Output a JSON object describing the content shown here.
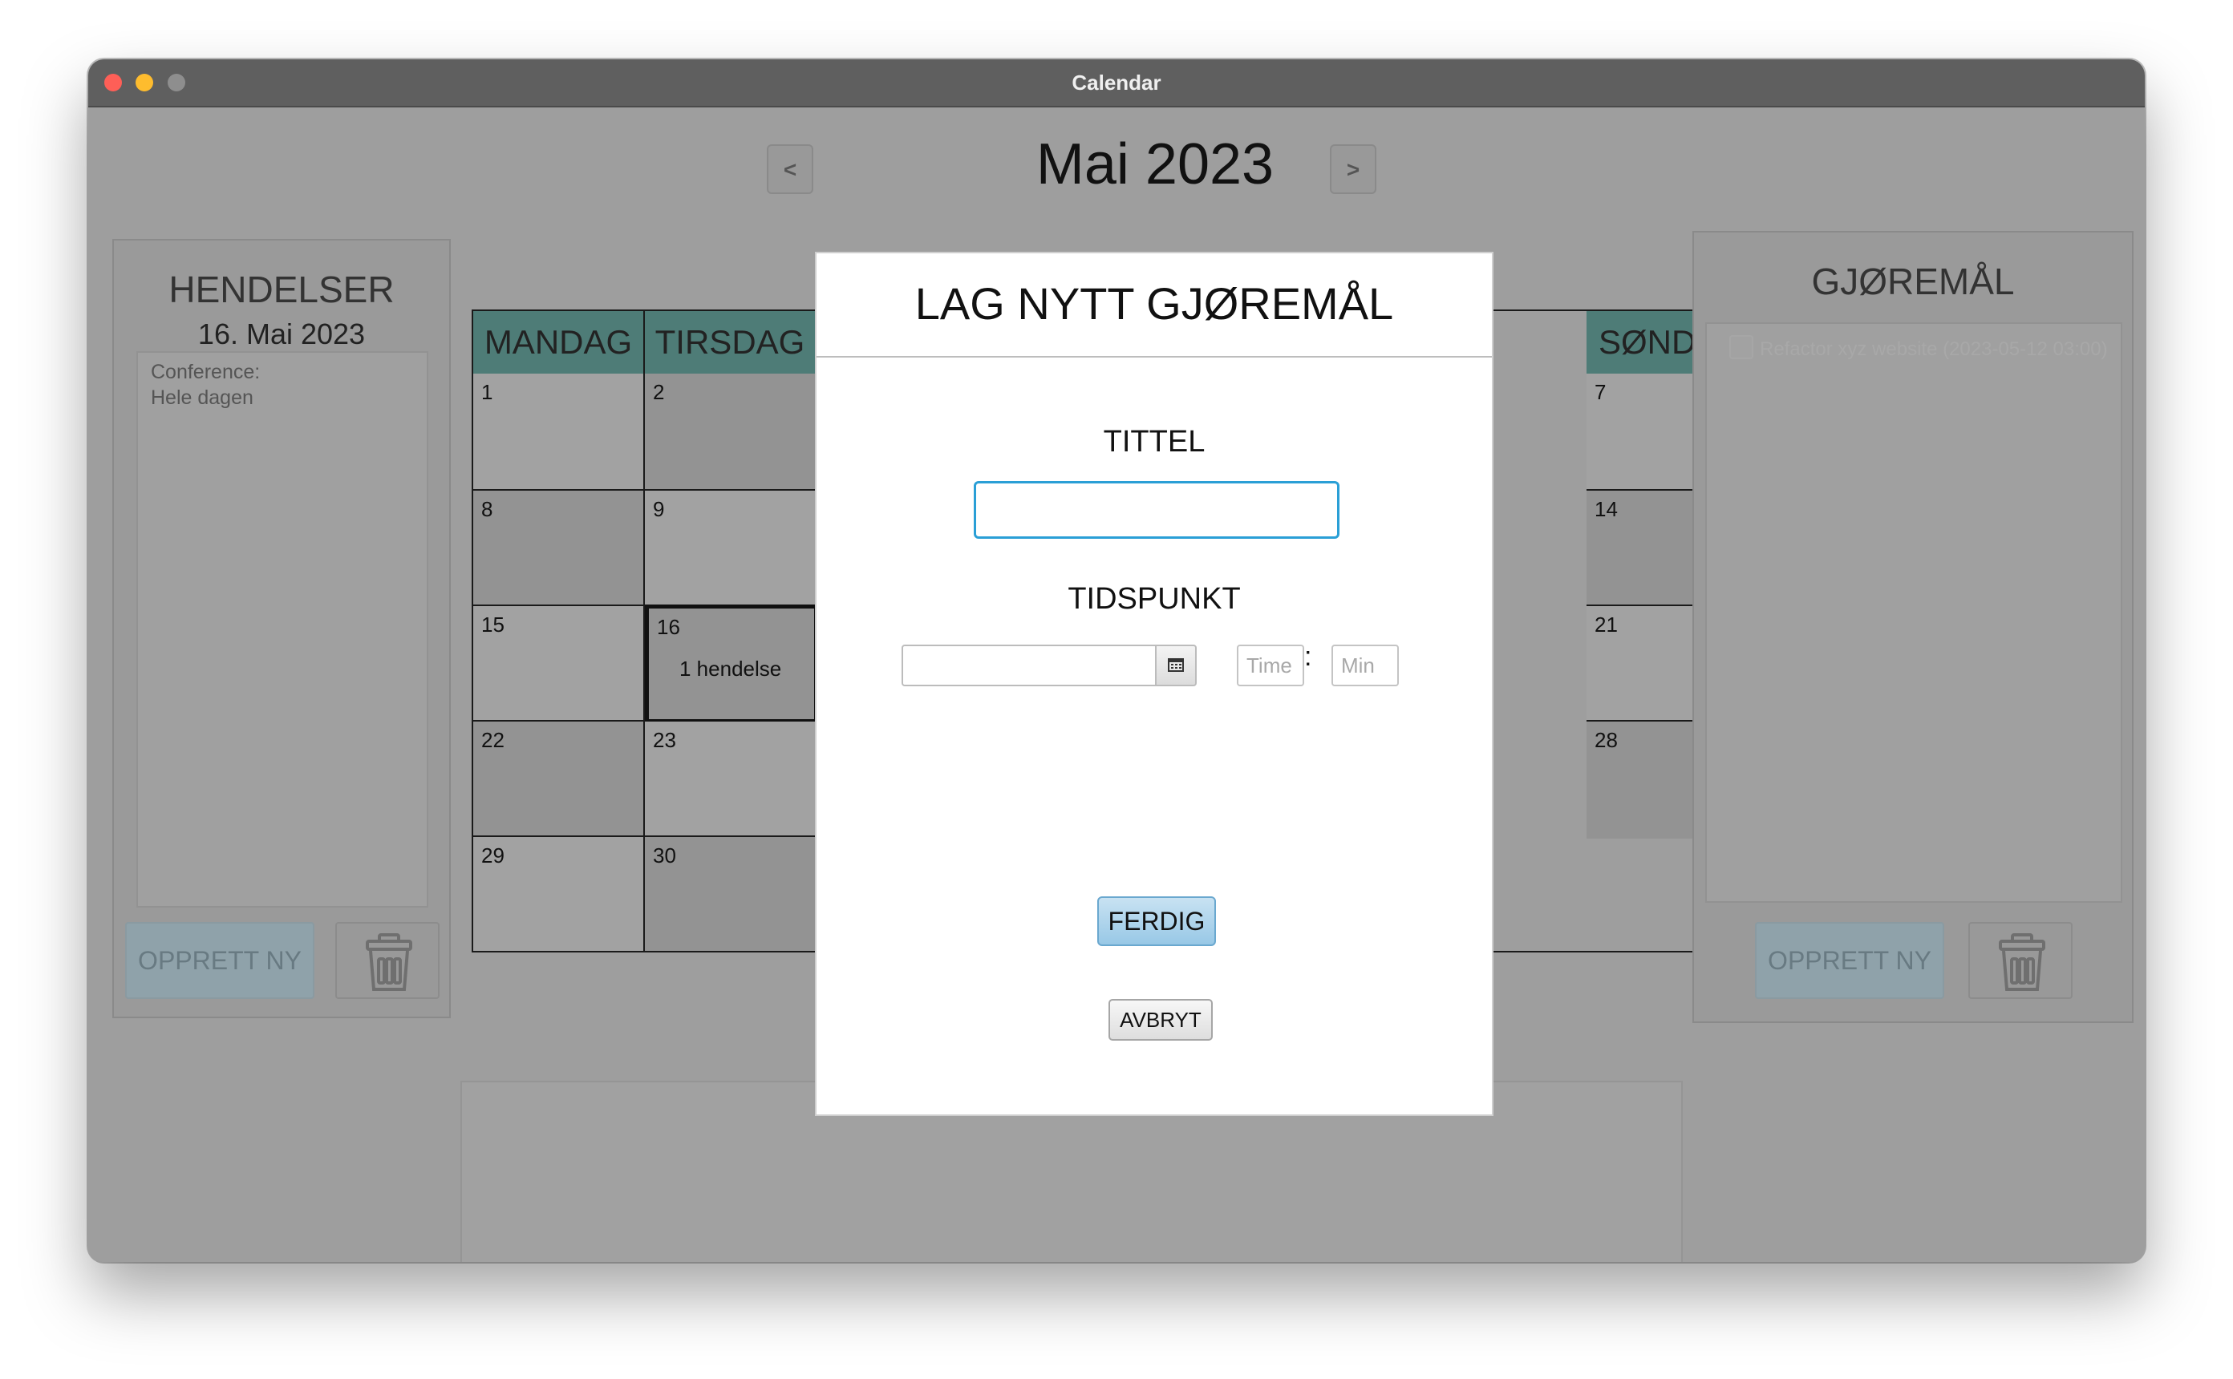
{
  "window": {
    "title": "Calendar"
  },
  "nav": {
    "prev_label": "<",
    "next_label": ">",
    "month_title": "Mai 2023"
  },
  "events_panel": {
    "title": "HENDELSER",
    "date": "16. Mai 2023",
    "items": [
      {
        "name": "Conference:",
        "time": "Hele dagen"
      }
    ],
    "create_label": "OPPRETT NY",
    "delete_icon": "trash-icon"
  },
  "calendar": {
    "day_headers": [
      "MANDAG",
      "TIRSDAG",
      "SØNDAG"
    ],
    "cells": {
      "mon": [
        "1",
        "8",
        "15",
        "22",
        "29"
      ],
      "tue": [
        "2",
        "9",
        "16",
        "23",
        "30"
      ],
      "sun": [
        "7",
        "14",
        "21",
        "28"
      ]
    },
    "event_count_label": "1 hendelse",
    "selected_day": "16"
  },
  "todo_panel": {
    "title": "GJØREMÅL",
    "items": [
      {
        "text": "Refactor xyz website (2023-05-12 03:00)",
        "done": false
      }
    ],
    "create_label": "OPPRETT NY",
    "delete_icon": "trash-icon"
  },
  "modal": {
    "title": "LAG NYTT GJØREMÅL",
    "title_label": "TITTEL",
    "title_value": "",
    "time_label": "TIDSPUNKT",
    "date_value": "",
    "date_picker_icon": "calendar-icon",
    "hour_placeholder": "Time",
    "minute_placeholder": "Min",
    "colon": ":",
    "done_label": "FERDIG",
    "cancel_label": "AVBRYT"
  },
  "colors": {
    "header_teal": "#4e7c77",
    "accent_blue": "#2a9fd6",
    "traffic_red": "#fe5f57",
    "traffic_yellow": "#febc2e"
  }
}
